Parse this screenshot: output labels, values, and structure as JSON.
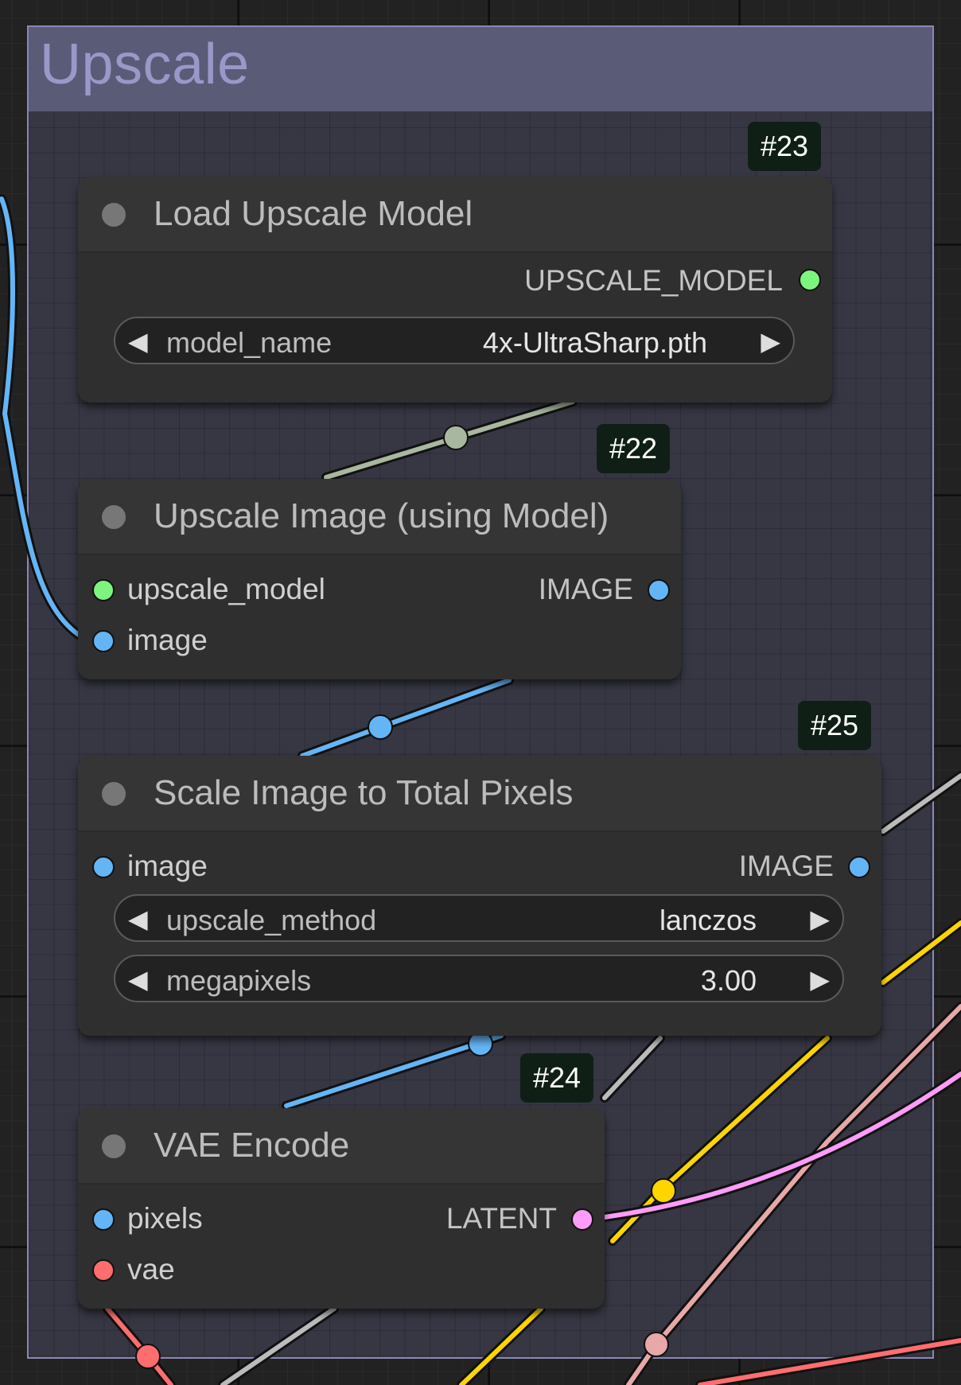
{
  "group": {
    "title": "Upscale"
  },
  "colors": {
    "group_border": "#8a88b8",
    "group_header": "#5a5b77",
    "model_wire": "#a8b8a0",
    "image_wire": "#64b5f6",
    "vae_wire": "#ff6e6e",
    "latent_wire": "#ff9cf9",
    "yellow_wire": "#ffd500",
    "pink_wire": "#e8a8a8",
    "gray_wire": "#bbbbbb"
  },
  "nodes": {
    "load_upscale_model": {
      "id": "#23",
      "title": "Load Upscale Model",
      "output_label": "UPSCALE_MODEL",
      "widget": {
        "label": "model_name",
        "value": "4x-UltraSharp.pth"
      }
    },
    "upscale_image": {
      "id": "#22",
      "title": "Upscale Image (using Model)",
      "inputs": [
        "upscale_model",
        "image"
      ],
      "output_label": "IMAGE"
    },
    "scale_total_pixels": {
      "id": "#25",
      "title": "Scale Image to Total Pixels",
      "input": "image",
      "output_label": "IMAGE",
      "widgets": [
        {
          "label": "upscale_method",
          "value": "lanczos"
        },
        {
          "label": "megapixels",
          "value": "3.00"
        }
      ]
    },
    "vae_encode": {
      "id": "#24",
      "title": "VAE Encode",
      "inputs": [
        "pixels",
        "vae"
      ],
      "output_label": "LATENT"
    }
  },
  "icons": {
    "arrow_left": "◀",
    "arrow_right": "▶"
  }
}
